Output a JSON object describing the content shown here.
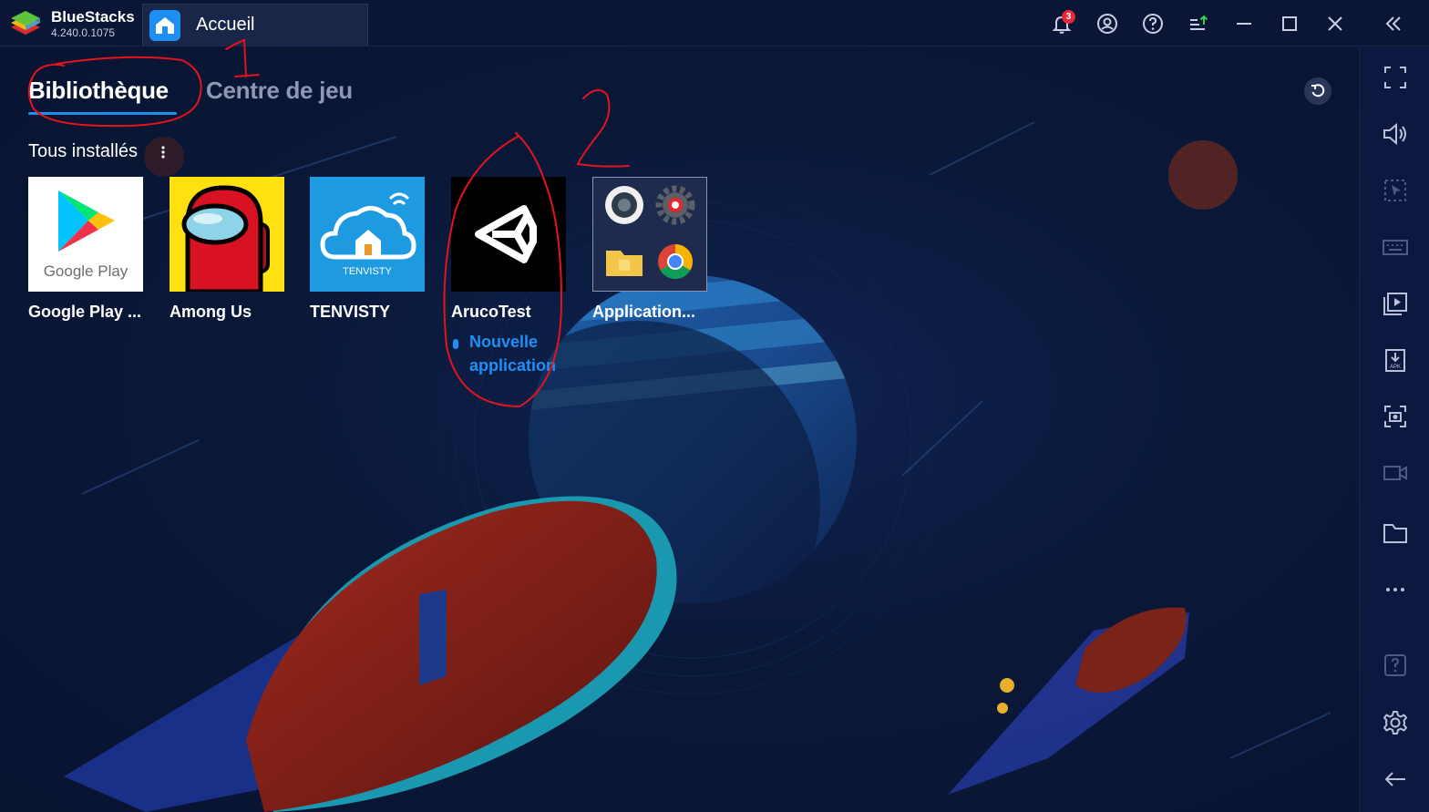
{
  "app": {
    "name": "BlueStacks",
    "version": "4.240.0.1075"
  },
  "tabs": {
    "home_label": "Accueil"
  },
  "titlebar": {
    "notification_count": "3",
    "icons": [
      "bell-icon",
      "account-icon",
      "help-icon",
      "update-icon",
      "minimize-icon",
      "maximize-icon",
      "close-icon",
      "collapse-icon"
    ]
  },
  "library": {
    "tab_library": "Bibliothèque",
    "tab_game_center": "Centre de jeu",
    "section_title": "Tous installés",
    "apps": [
      {
        "name": "Google Play ...",
        "icon": "google-play-icon"
      },
      {
        "name": "Among Us",
        "icon": "among-us-icon"
      },
      {
        "name": "TENVISTY",
        "icon": "tenvisty-icon",
        "icon_text": "TENVISTY"
      },
      {
        "name": "ArucoTest",
        "icon": "unity-icon",
        "tag": "Nouvelle application"
      },
      {
        "name": "Application...",
        "icon": "system-apps-folder-icon"
      }
    ],
    "google_play_logo_text": "Google Play"
  },
  "sidebar": {
    "icons": [
      "fullscreen-icon",
      "volume-icon",
      "pointer-icon",
      "keyboard-icon",
      "media-manager-icon",
      "apk-install-icon",
      "screenshot-icon",
      "record-icon",
      "folder-icon",
      "more-icon",
      "help-icon",
      "settings-icon",
      "back-icon"
    ]
  },
  "annotations": {
    "marks": [
      "1",
      "2"
    ]
  },
  "colors": {
    "accent": "#1f8ff5",
    "titlebar_bg": "#0b1636",
    "sidebar_bg": "#0c1840",
    "badge": "#e8293a",
    "annotation": "#e3141c"
  }
}
